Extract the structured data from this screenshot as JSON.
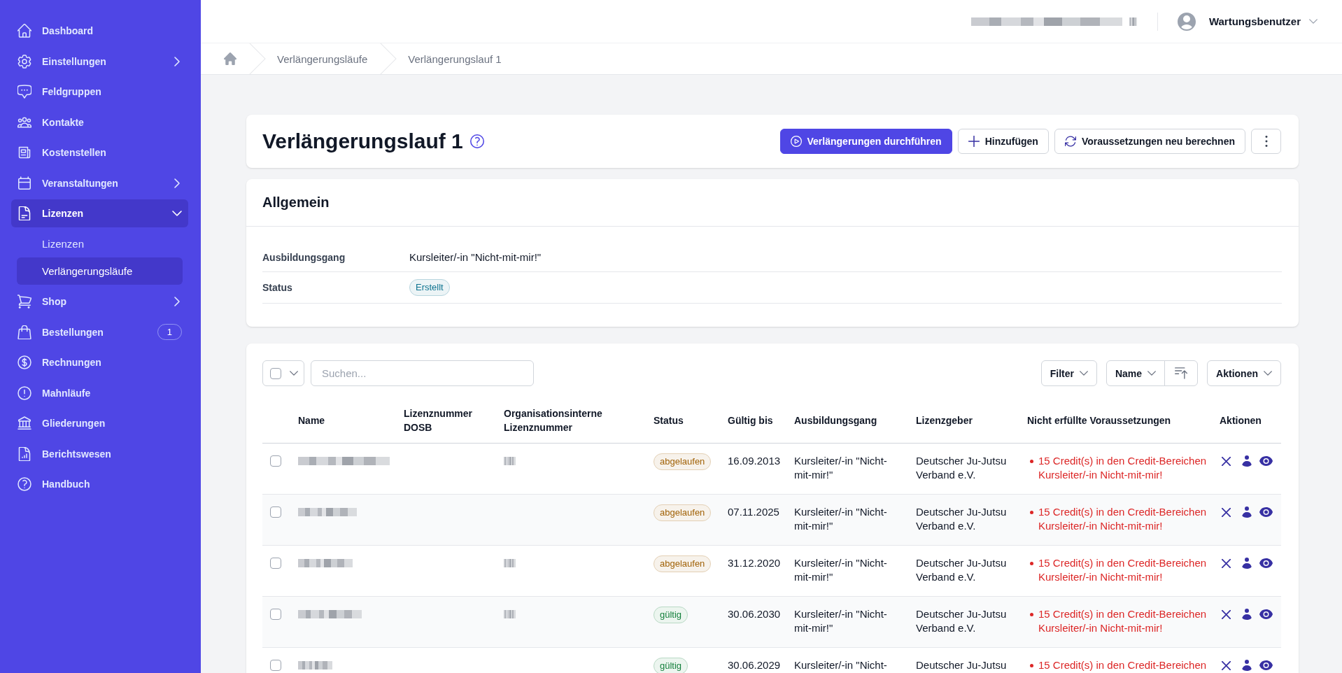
{
  "sidebar": {
    "items": [
      {
        "label": "Dashboard",
        "selected": false
      },
      {
        "label": "Einstellungen",
        "selected": false,
        "expanded": false
      },
      {
        "label": "Feldgruppen",
        "selected": false
      },
      {
        "label": "Kontakte",
        "selected": false
      },
      {
        "label": "Kostenstellen",
        "selected": false
      },
      {
        "label": "Veranstaltungen",
        "selected": false,
        "expanded": false
      },
      {
        "label": "Lizenzen",
        "selected": true,
        "expanded": true,
        "children": [
          {
            "label": "Lizenzen",
            "selected": false
          },
          {
            "label": "Verlängerungsläufe",
            "selected": true
          }
        ]
      },
      {
        "label": "Shop",
        "selected": false,
        "expanded": false
      },
      {
        "label": "Bestellungen",
        "selected": false,
        "badge": "1"
      },
      {
        "label": "Rechnungen",
        "selected": false
      },
      {
        "label": "Mahnläufe",
        "selected": false
      },
      {
        "label": "Gliederungen",
        "selected": false
      },
      {
        "label": "Berichtswesen",
        "selected": false
      },
      {
        "label": "Handbuch",
        "selected": false
      }
    ]
  },
  "topbar": {
    "account_redacted": true,
    "user": "Wartungsbenutzer"
  },
  "breadcrumb": {
    "items": [
      "Verlängerungsläufe",
      "Verlängerungslauf 1"
    ]
  },
  "header": {
    "title": "Verlängerungslauf 1",
    "buttons": [
      {
        "kind": "primary",
        "label": "Verlängerungen durchführen"
      },
      {
        "kind": "secondary",
        "label": "Hinzufügen"
      },
      {
        "kind": "secondary",
        "label": "Voraussetzungen neu berechnen"
      },
      {
        "kind": "more"
      }
    ]
  },
  "general": {
    "title": "Allgemein",
    "fields": [
      {
        "label": "Ausbildungsgang",
        "kind": "text",
        "value": "Kursleiter/-in \"Nicht-mit-mir!\""
      },
      {
        "label": "Status",
        "kind": "badge",
        "value": "Erstellt",
        "color": "#0e7490"
      }
    ]
  },
  "table": {
    "toolbar": {
      "select_all_checked": false,
      "search_placeholder": "Suchen...",
      "filter": "Filter",
      "sort": "Name",
      "actions": "Aktionen"
    },
    "columns": [
      "Name",
      "Lizenznummer DOSB",
      "Organisationsinterne Lizenznummer",
      "Status",
      "Gültig bis",
      "Ausbildungsgang",
      "Lizenzgeber",
      "Nicht erfüllte Voraussetzungen",
      "Aktionen"
    ],
    "rows": [
      {
        "checked": false,
        "name_redacted": true,
        "org_number_redacted": true,
        "status": {
          "label": "abgelaufen",
          "color": "#a16207"
        },
        "valid_until": "16.09.2013",
        "training": "Kursleiter/-in \"Nicht-mit-mir!\"",
        "issuer": "Deutscher Ju-Jutsu Verband e.V.",
        "unmet": [
          "15 Credit(s) in den Credit-Bereichen Kursleiter/-in Nicht-mit-mir!"
        ]
      },
      {
        "checked": false,
        "name_redacted": true,
        "org_number_redacted": false,
        "status": {
          "label": "abgelaufen",
          "color": "#a16207"
        },
        "valid_until": "07.11.2025",
        "training": "Kursleiter/-in \"Nicht-mit-mir!\"",
        "issuer": "Deutscher Ju-Jutsu Verband e.V.",
        "unmet": [
          "15 Credit(s) in den Credit-Bereichen Kursleiter/-in Nicht-mit-mir!"
        ]
      },
      {
        "checked": false,
        "name_redacted": true,
        "org_number_redacted": true,
        "status": {
          "label": "abgelaufen",
          "color": "#a16207"
        },
        "valid_until": "31.12.2020",
        "training": "Kursleiter/-in \"Nicht-mit-mir!\"",
        "issuer": "Deutscher Ju-Jutsu Verband e.V.",
        "unmet": [
          "15 Credit(s) in den Credit-Bereichen Kursleiter/-in Nicht-mit-mir!"
        ]
      },
      {
        "checked": false,
        "name_redacted": true,
        "org_number_redacted": true,
        "status": {
          "label": "gültig",
          "color": "#15803d"
        },
        "valid_until": "30.06.2030",
        "training": "Kursleiter/-in \"Nicht-mit-mir!\"",
        "issuer": "Deutscher Ju-Jutsu Verband e.V.",
        "unmet": [
          "15 Credit(s) in den Credit-Bereichen Kursleiter/-in Nicht-mit-mir!"
        ]
      },
      {
        "checked": false,
        "name_redacted": true,
        "org_number_redacted": false,
        "status": {
          "label": "gültig",
          "color": "#15803d"
        },
        "valid_until": "30.06.2029",
        "training": "Kursleiter/-in \"Nicht-",
        "issuer": "Deutscher Ju-Jutsu",
        "unmet": [
          "15 Credit(s) in den Credit-Bereichen"
        ]
      }
    ]
  }
}
